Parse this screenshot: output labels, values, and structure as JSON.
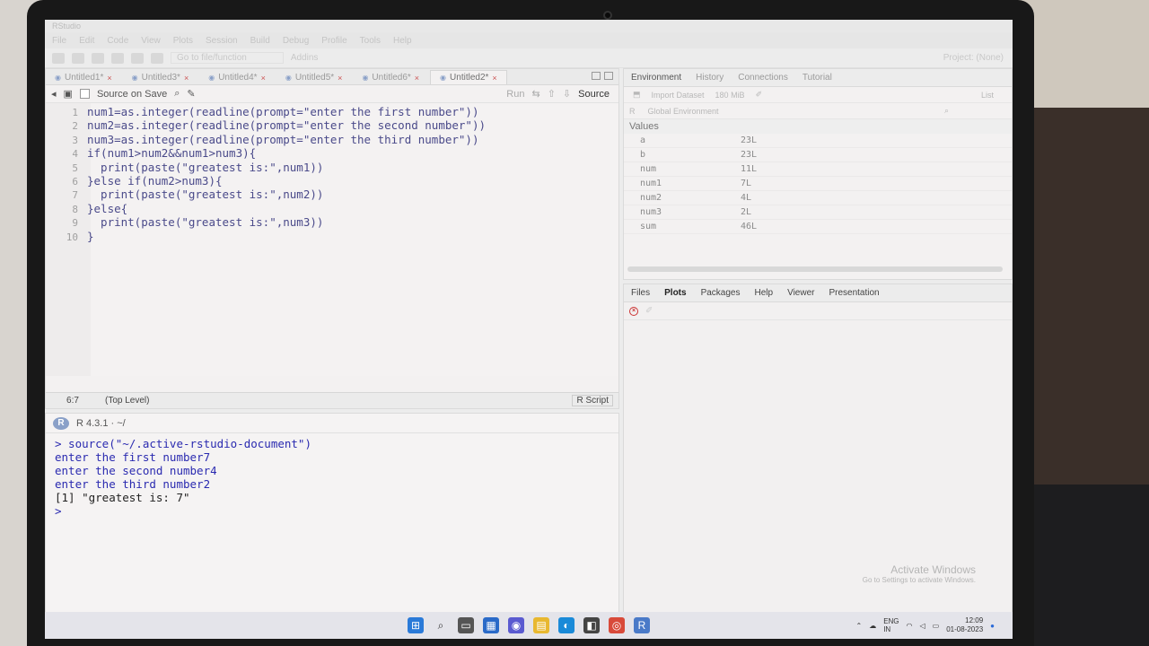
{
  "window": {
    "title": "RStudio"
  },
  "menu": [
    "File",
    "Edit",
    "Code",
    "View",
    "Plots",
    "Session",
    "Build",
    "Debug",
    "Profile",
    "Tools",
    "Help"
  ],
  "toolbar": {
    "goto_placeholder": "Go to file/function",
    "addins": "Addins",
    "project": "Project: (None)"
  },
  "editor": {
    "tabs": [
      "Untitled1*",
      "Untitled3*",
      "Untitled4*",
      "Untitled5*",
      "Untitled6*",
      "Untitled2*"
    ],
    "active_tab": "Untitled2*",
    "source_on_save": "Source on Save",
    "run_label": "Run",
    "source_label": "Source",
    "lines": [
      {
        "n": "1",
        "text": "num1=as.integer(readline(prompt=\"enter the first number\"))"
      },
      {
        "n": "2",
        "text": "num2=as.integer(readline(prompt=\"enter the second number\"))"
      },
      {
        "n": "3",
        "text": "num3=as.integer(readline(prompt=\"enter the third number\"))"
      },
      {
        "n": "4",
        "text": "if(num1>num2&&num1>num3){"
      },
      {
        "n": "5",
        "text": "  print(paste(\"greatest is:\",num1))"
      },
      {
        "n": "6",
        "text": "}else if(num2>num3){"
      },
      {
        "n": "7",
        "text": "  print(paste(\"greatest is:\",num2))"
      },
      {
        "n": "8",
        "text": "}else{"
      },
      {
        "n": "9",
        "text": "  print(paste(\"greatest is:\",num3))"
      },
      {
        "n": "10",
        "text": "}"
      }
    ],
    "status": {
      "position": "6:7",
      "level": "(Top Level)",
      "filetype": "R Script"
    }
  },
  "console": {
    "version": "R 4.3.1 · ~/",
    "lines": [
      {
        "text": "> source(\"~/.active-rstudio-document\")",
        "kind": "cmd"
      },
      {
        "text": "enter the first number7",
        "kind": "cmd"
      },
      {
        "text": "enter the second number4",
        "kind": "cmd"
      },
      {
        "text": "enter the third number2",
        "kind": "cmd"
      },
      {
        "text": "[1] \"greatest is: 7\"",
        "kind": "out"
      },
      {
        "text": ">",
        "kind": "cmd"
      }
    ]
  },
  "environment": {
    "tabs": [
      "Environment",
      "History",
      "Connections",
      "Tutorial"
    ],
    "import_dataset": "Import Dataset",
    "memory": "180 MiB",
    "list_label": "List",
    "r_label": "R",
    "global_env": "Global Environment",
    "values_header": "Values",
    "rows": [
      {
        "name": "a",
        "value": "23L"
      },
      {
        "name": "b",
        "value": "23L"
      },
      {
        "name": "num",
        "value": "11L"
      },
      {
        "name": "num1",
        "value": "7L"
      },
      {
        "name": "num2",
        "value": "4L"
      },
      {
        "name": "num3",
        "value": "2L"
      },
      {
        "name": "sum",
        "value": "46L"
      }
    ]
  },
  "files_pane": {
    "tabs": [
      "Files",
      "Plots",
      "Packages",
      "Help",
      "Viewer",
      "Presentation"
    ],
    "active_tab": "Plots"
  },
  "watermark": {
    "title": "Activate Windows",
    "subtitle": "Go to Settings to activate Windows."
  },
  "tray": {
    "lang": "ENG",
    "region": "IN",
    "time": "12:09",
    "date": "01-08-2023"
  }
}
